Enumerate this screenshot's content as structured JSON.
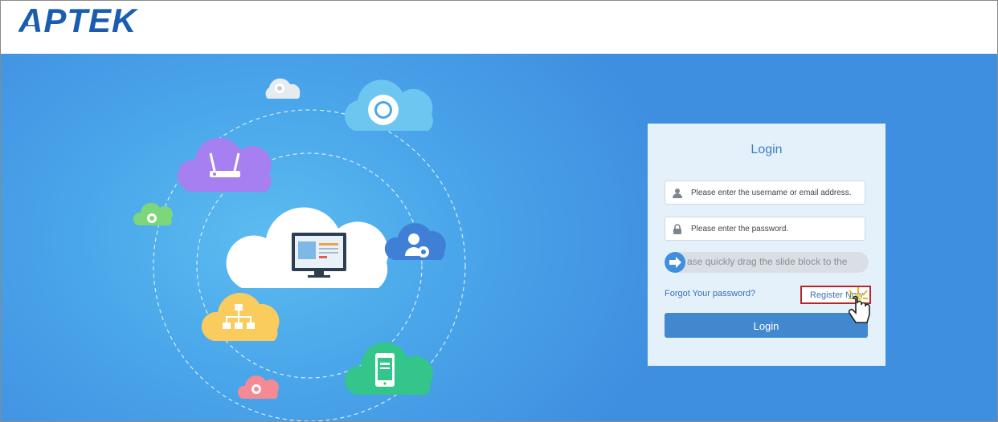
{
  "header": {
    "logo_text": "APTEK"
  },
  "login": {
    "title": "Login",
    "username_placeholder": "Please enter the username or email address.",
    "password_placeholder": "Please enter the password.",
    "slider_text": "ase quickly drag the slide block to the",
    "forgot_label": "Forgot Your password?",
    "register_label": "Register Now",
    "login_button": "Login"
  },
  "icons": {
    "user": "user-icon",
    "lock": "lock-icon",
    "arrow": "arrow-right-icon",
    "cursor": "hand-cursor-icon"
  },
  "colors": {
    "brand": "#1a5db0",
    "hero_blue": "#4aa6ea",
    "accent": "#4288cf",
    "highlight_border": "#b4262b"
  }
}
